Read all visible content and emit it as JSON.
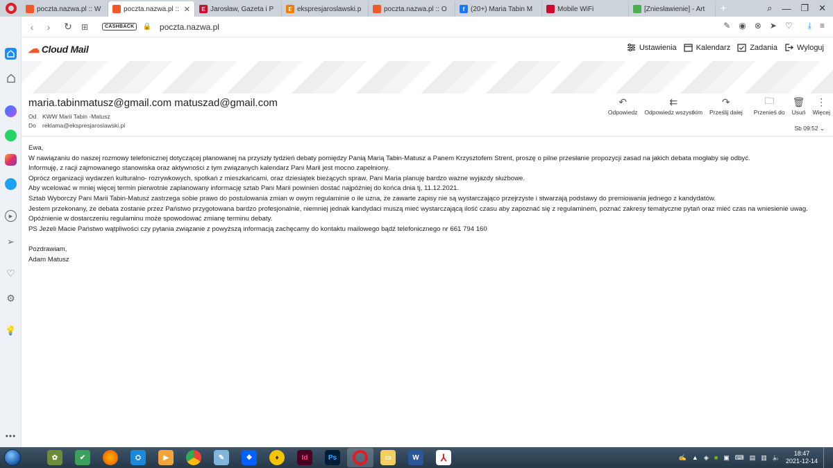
{
  "browser": {
    "tabs": [
      {
        "title": "poczta.nazwa.pl :: W",
        "fav": "#f05a28",
        "favtext": "",
        "active": false
      },
      {
        "title": "poczta.nazwa.pl :: m",
        "fav": "#f05a28",
        "favtext": "",
        "active": true
      },
      {
        "title": "Jarosław, Gazeta i P",
        "fav": "#c8102e",
        "favtext": "E",
        "active": false
      },
      {
        "title": "ekspresjaroslawski.p",
        "fav": "#f07d00",
        "favtext": "E",
        "active": false
      },
      {
        "title": "poczta.nazwa.pl :: O",
        "fav": "#f05a28",
        "favtext": "",
        "active": false
      },
      {
        "title": "(20+) Maria Tabin M",
        "fav": "#1877f2",
        "favtext": "f",
        "active": false
      },
      {
        "title": "Mobile WiFi",
        "fav": "#cf0a2c",
        "favtext": "",
        "active": false
      },
      {
        "title": "[Zniesławienie] - Art",
        "fav": "#4caf50",
        "favtext": "",
        "active": false
      }
    ],
    "cashback_label": "CASHBACK",
    "url": "poczta.nazwa.pl"
  },
  "app": {
    "logo_text": "Cloud Mail",
    "nav": {
      "settings": "Ustawienia",
      "calendar": "Kalendarz",
      "tasks": "Zadania",
      "logout": "Wyloguj"
    }
  },
  "message": {
    "recipients": "maria.tabinmatusz@gmail.com matuszad@gmail.com",
    "from_label": "Od",
    "from_value": "KWW Marii Tabin -Matusz",
    "to_label": "Do",
    "to_value": "reklama@ekspresjaroslawski.pl",
    "date": "Sb 09:52",
    "actions": {
      "reply": "Odpowiedz",
      "reply_all": "Odpowiedz wszystkim",
      "forward": "Prześlij dalej",
      "move": "Przenieś do",
      "delete": "Usuń",
      "more": "Więcej"
    },
    "body": {
      "greeting": "Ewa,",
      "p1": "W nawiązaniu  do naszej rozmowy  telefonicznej  dotyczącej  planowanej  na przyszły tydzień  debaty  pomiędzy Panią Marią Tabin-Matusz a Panem Krzysztofem Strent, proszę o pilne  przesłanie propozycji zasad na jakich debata mogłaby się odbyć.",
      "p2": "Informuję, z racji zajmowanego stanowiska oraz  aktywności z tym związanych kalendarz Pani Marii jest mocno zapełniony.",
      "p3": "Oprócz organizacji wydarzeń  kulturalno- rozrywkowych, spotkań  z mieszkańcami, oraz dziesiątek  bieżących spraw, Pani Maria planuję  bardzo ważne wyjazdy służbowe.",
      "p4": "Aby wcelować w mniej więcej termin pierwotnie zaplanowany informację sztab Pani Marii powinien dostać  najpóźniej do końca dnia tj, 11.12.2021.",
      "p5": "Sztab Wyborczy Pani Marii Tabin-Matusz zastrzega sobie prawo do postulowania zmian w owym regulaminie o ile uzna, że zawarte zapisy nie są wystarczająco przejrzyste i stwarzają podstawy do premiowania jednego z kandydatów.",
      "p6": "Jestem przekonany, że debata zostanie przez Państwo  przygotowana bardzo profesjonalnie, niemniej jednak  kandydaci muszą mieć wystarczającą ilość czasu aby zapoznać  się z regulaminem, poznać zakresy tematyczne pytań oraz mieć czas na wniesienie uwag.",
      "p7": "Opóźnienie w dostarczeniu regulaminu może spowodować zmianę terminu debaty.",
      "p8": "PS  Jeżeli  Macie Państwo wątpliwości czy pytania związanie z powyższą informacją  zachęcamy  do  kontaktu mailowego  bądź telefonicznego nr 661 794 160",
      "closing": "Pozdrawiam,",
      "signature": "Adam Matusz"
    }
  },
  "taskbar": {
    "time": "18:47",
    "date": "2021-12-14"
  }
}
